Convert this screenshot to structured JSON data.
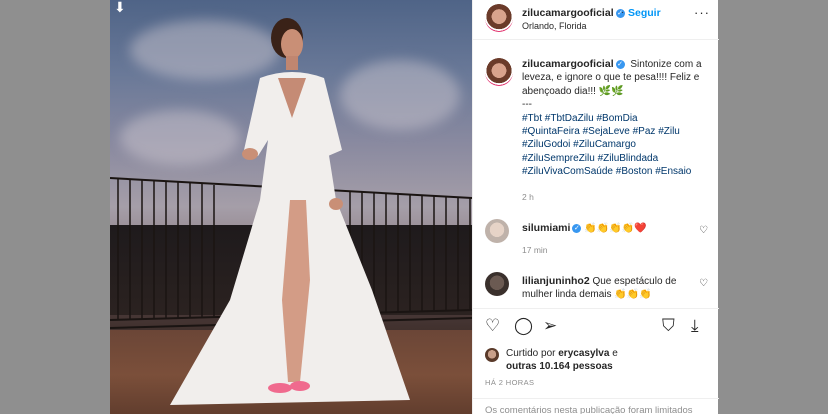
{
  "post": {
    "username": "zilucamargooficial",
    "follow_label": "Seguir",
    "location": "Orlando, Florida",
    "caption_text": "Sintonize com a leveza, e ignore o que te pesa!!!! Feliz e abençoado dia!!! 🌿🌿",
    "caption_separator": "---",
    "hashtags": [
      "#Tbt #TbtDaZilu #BomDia",
      "#QuintaFeira #SejaLeve #Paz #Zilu",
      "#ZiluGodoi #ZiluCamargo",
      "#ZiluSempreZilu #ZiluBlindada",
      "#ZiluVivaComSaúde #Boston #Ensaio"
    ],
    "caption_time": "2 h",
    "liked_by_prefix": "Curtido por",
    "liked_by_user": "erycasylva",
    "liked_by_and": "e",
    "liked_by_others": "outras 10.164 pessoas",
    "post_time": "HÁ 2 HORAS",
    "footer_text": "Os comentários nesta publicação foram limitados"
  },
  "comments": [
    {
      "username": "silumiami",
      "text": "👏👏👏👏❤️",
      "time": "17 min"
    },
    {
      "username": "lilianjuninho2",
      "text": "Que espetáculo de mulher linda demais 👏👏👏",
      "time": ""
    }
  ],
  "icons": {
    "download": "download-icon",
    "more": "more-options-icon",
    "like": "heart-icon",
    "comment": "comment-icon",
    "share": "share-icon",
    "save": "bookmark-icon"
  },
  "colors": {
    "link_blue": "#0095f6",
    "hashtag": "#00376b",
    "verified": "#3897f0",
    "muted": "#8e8e8e"
  }
}
